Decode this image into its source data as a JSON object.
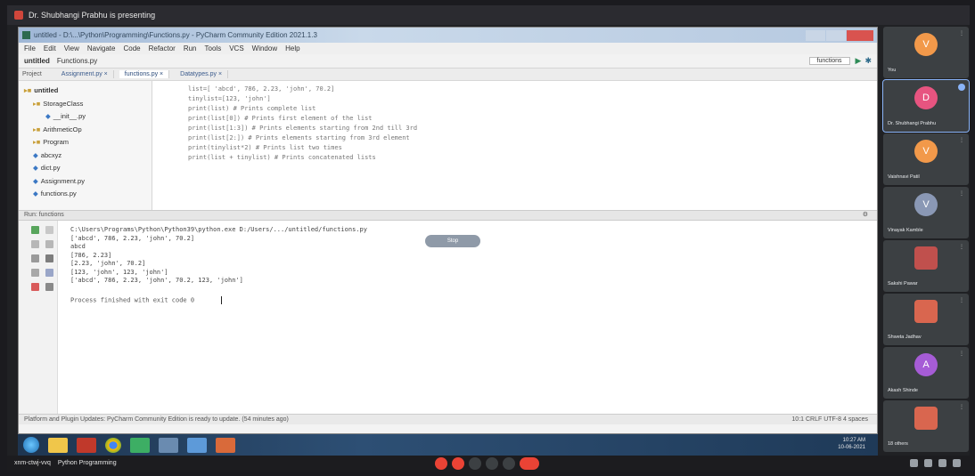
{
  "meet": {
    "title": "Dr. Shubhangi Prabhu is presenting",
    "meeting_code": "xnm-ctwj-vvq",
    "meeting_name": "Python Programming"
  },
  "ide": {
    "window_title": "untitled - D:\\...\\Python\\Programming\\Functions.py - PyCharm Community Edition 2021.1.3",
    "menus": [
      "File",
      "Edit",
      "View",
      "Navigate",
      "Code",
      "Refactor",
      "Run",
      "Tools",
      "VCS",
      "Window",
      "Help"
    ],
    "project_name": "untitled",
    "breadcrumb_file": "Functions.py",
    "run_config": "functions",
    "project_header": "Project",
    "tabs": [
      "Assignment.py",
      "functions.py",
      "Datatypes.py"
    ],
    "tree": [
      {
        "label": "untitled",
        "level": "root",
        "kind": "folder"
      },
      {
        "label": "StorageClass",
        "level": "lvl1",
        "kind": "folder"
      },
      {
        "label": "__init__.py",
        "level": "lvl2",
        "kind": "file"
      },
      {
        "label": "ArithmeticOp",
        "level": "lvl1",
        "kind": "folder"
      },
      {
        "label": "Program",
        "level": "lvl1",
        "kind": "folder"
      },
      {
        "label": "abcxyz",
        "level": "lvl1",
        "kind": "file"
      },
      {
        "label": "dict.py",
        "level": "lvl1",
        "kind": "file"
      },
      {
        "label": "Assignment.py",
        "level": "lvl1",
        "kind": "file"
      },
      {
        "label": "functions.py",
        "level": "lvl1",
        "kind": "file"
      }
    ],
    "code_lines": [
      "list=[ 'abcd', 786, 2.23, 'john', 70.2]",
      "tinylist=[123, 'john']",
      "print(list)          # Prints complete list",
      "print(list[0])       # Prints first element of the list",
      "print(list[1:3])     # Prints elements starting from 2nd till 3rd",
      "print(list[2:])      # Prints elements starting from 3rd element",
      "print(tinylist*2)    # Prints list two times",
      "print(list + tinylist) # Prints concatenated lists"
    ],
    "run_header": "Run: functions",
    "console_lines": [
      "C:\\Users\\Programs\\Python\\Python39\\python.exe D:/Users/.../untitled/functions.py",
      "['abcd', 786, 2.23, 'john', 70.2]",
      "abcd",
      "[786, 2.23]",
      "[2.23, 'john', 70.2]",
      "[123, 'john', 123, 'john']",
      "['abcd', 786, 2.23, 'john', 70.2, 123, 'john']"
    ],
    "console_exit": "Process finished with exit code 0",
    "pill_text": "Stop",
    "status_text": "Platform and Plugin Updates: PyCharm Community Edition is ready to update. (54 minutes ago)",
    "status_right": "10:1  CRLF  UTF-8  4 spaces"
  },
  "taskbar": {
    "time": "10:27 AM",
    "date": "10-06-2021"
  },
  "participants": [
    {
      "name": "You",
      "initial": "V",
      "color": "#f2994a",
      "photo": false,
      "selected": false
    },
    {
      "name": "Dr. Shubhangi Prabhu",
      "initial": "D",
      "color": "#e75480",
      "photo": false,
      "selected": true
    },
    {
      "name": "Vaishnavi Patil",
      "initial": "V",
      "color": "#f2994a",
      "photo": false,
      "selected": false
    },
    {
      "name": "Vinayak Kamble",
      "initial": "V",
      "color": "#8a98b5",
      "photo": false,
      "selected": false
    },
    {
      "name": "Sakshi Pawar",
      "initial": "",
      "color": "#c0504d",
      "photo": true,
      "selected": false
    },
    {
      "name": "Shweta Jadhav",
      "initial": "",
      "color": "#d9664f",
      "photo": true,
      "selected": false
    },
    {
      "name": "Akash Shinde",
      "initial": "A",
      "color": "#a65cd6",
      "photo": false,
      "selected": false
    },
    {
      "name": "18 others",
      "initial": "",
      "color": "#d9664f",
      "photo": true,
      "selected": false
    }
  ]
}
